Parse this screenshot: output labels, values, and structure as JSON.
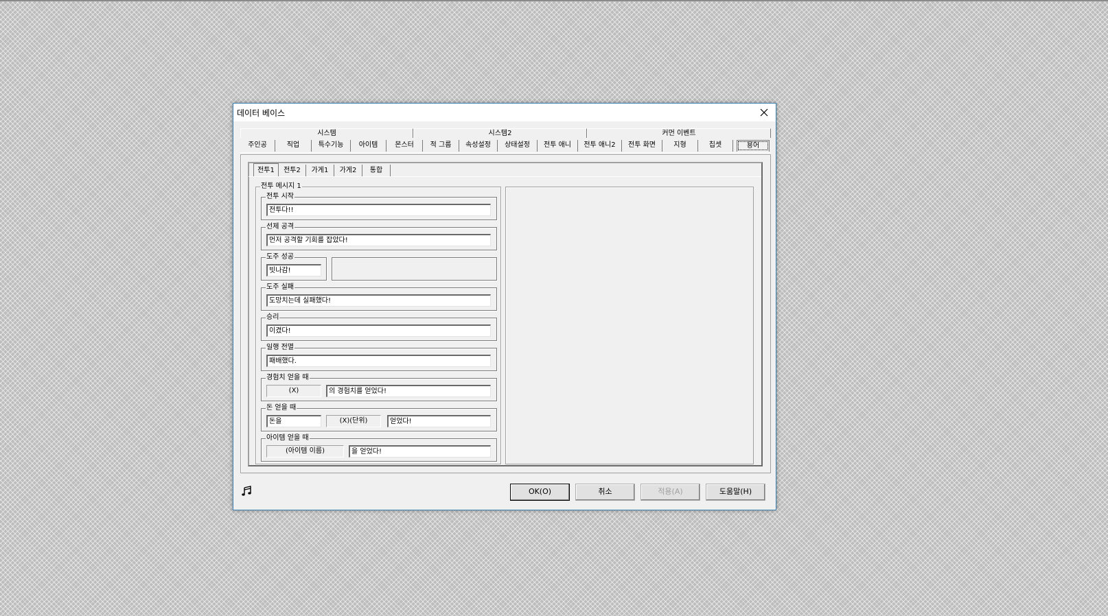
{
  "window": {
    "title": "데이터 베이스"
  },
  "group_tabs": [
    "시스템",
    "시스템2",
    "커먼 이벤트"
  ],
  "tabs": [
    "주인공",
    "직업",
    "특수기능",
    "아이템",
    "몬스터",
    "적 그룹",
    "속성설정",
    "상태설정",
    "전투 애니",
    "전투 애니2",
    "전투 화면",
    "지형",
    "칩셋",
    "용어"
  ],
  "selected_tab": "용어",
  "subtabs": [
    "전투1",
    "전투2",
    "가게1",
    "가게2",
    "통합"
  ],
  "selected_subtab": "전투1",
  "battle_messages": {
    "title": "전투 메시지 1",
    "battle_start": {
      "label": "전투 시작",
      "value": "전투다!!"
    },
    "preemptive": {
      "label": "선제 공격",
      "value": "먼저 공격할 기회를 잡았다!"
    },
    "escape_success": {
      "label": "도주 성공",
      "value": "빗나감!"
    },
    "escape_fail": {
      "label": "도주 실패",
      "value": "도망치는데 실패했다!"
    },
    "victory": {
      "label": "승리",
      "value": "이겼다!"
    },
    "defeat": {
      "label": "일행 전멸",
      "value": "패배했다."
    },
    "exp_gain": {
      "label": "경험치 얻을 때",
      "placeholder": "(X)",
      "value": "의 경험치를 얻었다!"
    },
    "gold_gain": {
      "label": "돈 얻을 때",
      "prefix": "돈을",
      "placeholder": "(X)(단위)",
      "value": "얻었다!"
    },
    "item_gain": {
      "label": "아이템 얻을 때",
      "placeholder": "(아이템 이름)",
      "value": "을 얻었다!"
    }
  },
  "buttons": {
    "ok": "OK(O)",
    "cancel": "취소",
    "apply": "적용(A)",
    "help": "도움말(H)"
  }
}
